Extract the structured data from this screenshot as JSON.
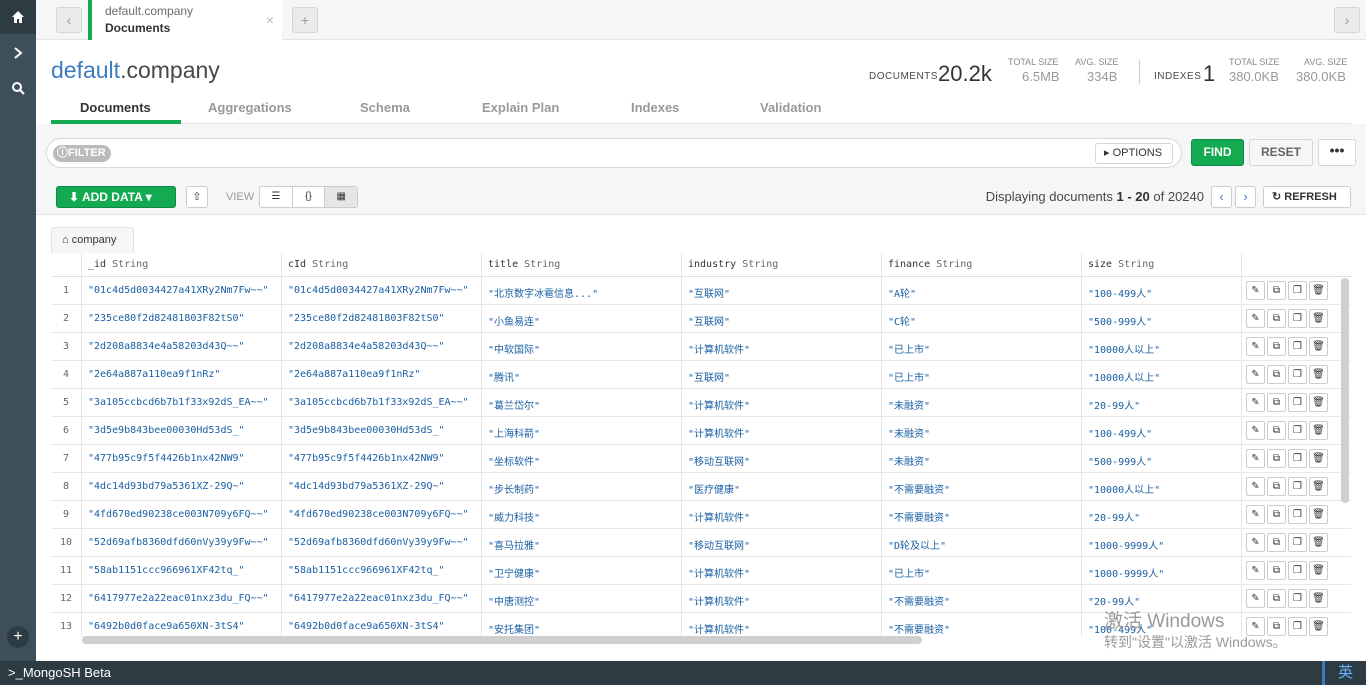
{
  "window": {
    "tab": {
      "title": "default.company",
      "subtitle": "Documents"
    },
    "new_tab_label": "+",
    "close_label": "×"
  },
  "header": {
    "db": "default",
    "collection": ".company",
    "documents_label": "DOCUMENTS",
    "documents_value": "20.2k",
    "total_size_label": "TOTAL SIZE",
    "total_size_value": "6.5MB",
    "avg_size_label": "AVG. SIZE",
    "avg_size_value": "334B",
    "indexes_label": "INDEXES",
    "indexes_value": "1",
    "idx_total_size_label": "TOTAL SIZE",
    "idx_total_size_value": "380.0KB",
    "idx_avg_size_label": "AVG. SIZE",
    "idx_avg_size_value": "380.0KB"
  },
  "tabs": [
    "Documents",
    "Aggregations",
    "Schema",
    "Explain Plan",
    "Indexes",
    "Validation"
  ],
  "filter": {
    "pill": "FILTER",
    "options": "OPTIONS",
    "find": "FIND",
    "reset": "RESET",
    "more": "•••"
  },
  "toolbar": {
    "add_data": "ADD DATA",
    "view_label": "VIEW",
    "displaying_prefix": "Displaying documents",
    "range": "1 - 20",
    "of": "of",
    "total": "20240",
    "refresh": "REFRESH"
  },
  "collection_tab": "company",
  "columns": [
    {
      "name": "_id",
      "type": "String"
    },
    {
      "name": "cId",
      "type": "String"
    },
    {
      "name": "title",
      "type": "String"
    },
    {
      "name": "industry",
      "type": "String"
    },
    {
      "name": "finance",
      "type": "String"
    },
    {
      "name": "size",
      "type": "String"
    }
  ],
  "rows": [
    {
      "n": "1",
      "id": "\"01c4d5d0034427a41XRy2Nm7Fw~~\"",
      "cid": "\"01c4d5d0034427a41XRy2Nm7Fw~~\"",
      "title": "\"北京数字冰雹信息...\"",
      "industry": "\"互联网\"",
      "finance": "\"A轮\"",
      "size": "\"100-499人\""
    },
    {
      "n": "2",
      "id": "\"235ce80f2d82481803F82tS0\"",
      "cid": "\"235ce80f2d82481803F82tS0\"",
      "title": "\"小鱼易连\"",
      "industry": "\"互联网\"",
      "finance": "\"C轮\"",
      "size": "\"500-999人\""
    },
    {
      "n": "3",
      "id": "\"2d208a8834e4a58203d43Q~~\"",
      "cid": "\"2d208a8834e4a58203d43Q~~\"",
      "title": "\"中软国际\"",
      "industry": "\"计算机软件\"",
      "finance": "\"已上市\"",
      "size": "\"10000人以上\""
    },
    {
      "n": "4",
      "id": "\"2e64a887a110ea9f1nRz\"",
      "cid": "\"2e64a887a110ea9f1nRz\"",
      "title": "\"腾讯\"",
      "industry": "\"互联网\"",
      "finance": "\"已上市\"",
      "size": "\"10000人以上\""
    },
    {
      "n": "5",
      "id": "\"3a105ccbcd6b7b1f33x92dS_EA~~\"",
      "cid": "\"3a105ccbcd6b7b1f33x92dS_EA~~\"",
      "title": "\"葛兰岱尔\"",
      "industry": "\"计算机软件\"",
      "finance": "\"未融资\"",
      "size": "\"20-99人\""
    },
    {
      "n": "6",
      "id": "\"3d5e9b843bee00030Hd53dS_\"",
      "cid": "\"3d5e9b843bee00030Hd53dS_\"",
      "title": "\"上海科箭\"",
      "industry": "\"计算机软件\"",
      "finance": "\"未融资\"",
      "size": "\"100-499人\""
    },
    {
      "n": "7",
      "id": "\"477b95c9f5f4426b1nx42NW9\"",
      "cid": "\"477b95c9f5f4426b1nx42NW9\"",
      "title": "\"坐标软件\"",
      "industry": "\"移动互联网\"",
      "finance": "\"未融资\"",
      "size": "\"500-999人\""
    },
    {
      "n": "8",
      "id": "\"4dc14d93bd79a5361XZ-29Q~\"",
      "cid": "\"4dc14d93bd79a5361XZ-29Q~\"",
      "title": "\"步长制药\"",
      "industry": "\"医疗健康\"",
      "finance": "\"不需要融资\"",
      "size": "\"10000人以上\""
    },
    {
      "n": "9",
      "id": "\"4fd670ed90238ce003N709y6FQ~~\"",
      "cid": "\"4fd670ed90238ce003N709y6FQ~~\"",
      "title": "\"威力科技\"",
      "industry": "\"计算机软件\"",
      "finance": "\"不需要融资\"",
      "size": "\"20-99人\""
    },
    {
      "n": "10",
      "id": "\"52d69afb8360dfd60nVy39y9Fw~~\"",
      "cid": "\"52d69afb8360dfd60nVy39y9Fw~~\"",
      "title": "\"喜马拉雅\"",
      "industry": "\"移动互联网\"",
      "finance": "\"D轮及以上\"",
      "size": "\"1000-9999人\""
    },
    {
      "n": "11",
      "id": "\"58ab1151ccc966961XF42tq_\"",
      "cid": "\"58ab1151ccc966961XF42tq_\"",
      "title": "\"卫宁健康\"",
      "industry": "\"计算机软件\"",
      "finance": "\"已上市\"",
      "size": "\"1000-9999人\""
    },
    {
      "n": "12",
      "id": "\"6417977e2a22eac01nxz3du_FQ~~\"",
      "cid": "\"6417977e2a22eac01nxz3du_FQ~~\"",
      "title": "\"中唐测控\"",
      "industry": "\"计算机软件\"",
      "finance": "\"不需要融资\"",
      "size": "\"20-99人\""
    },
    {
      "n": "13",
      "id": "\"6492b0d0face9a650XN-3tS4\"",
      "cid": "\"6492b0d0face9a650XN-3tS4\"",
      "title": "\"安托集团\"",
      "industry": "\"计算机软件\"",
      "finance": "\"不需要融资\"",
      "size": "\"100-499人\""
    }
  ],
  "watermark": {
    "line1": "激活 Windows",
    "line2": "转到\"设置\"以激活 Windows。"
  },
  "shell": {
    "label": ">_MongoSH Beta",
    "ime": "英"
  },
  "colors": {
    "accent": "#13aa52",
    "link": "#3b7bbf",
    "rail": "#3d4f58"
  }
}
